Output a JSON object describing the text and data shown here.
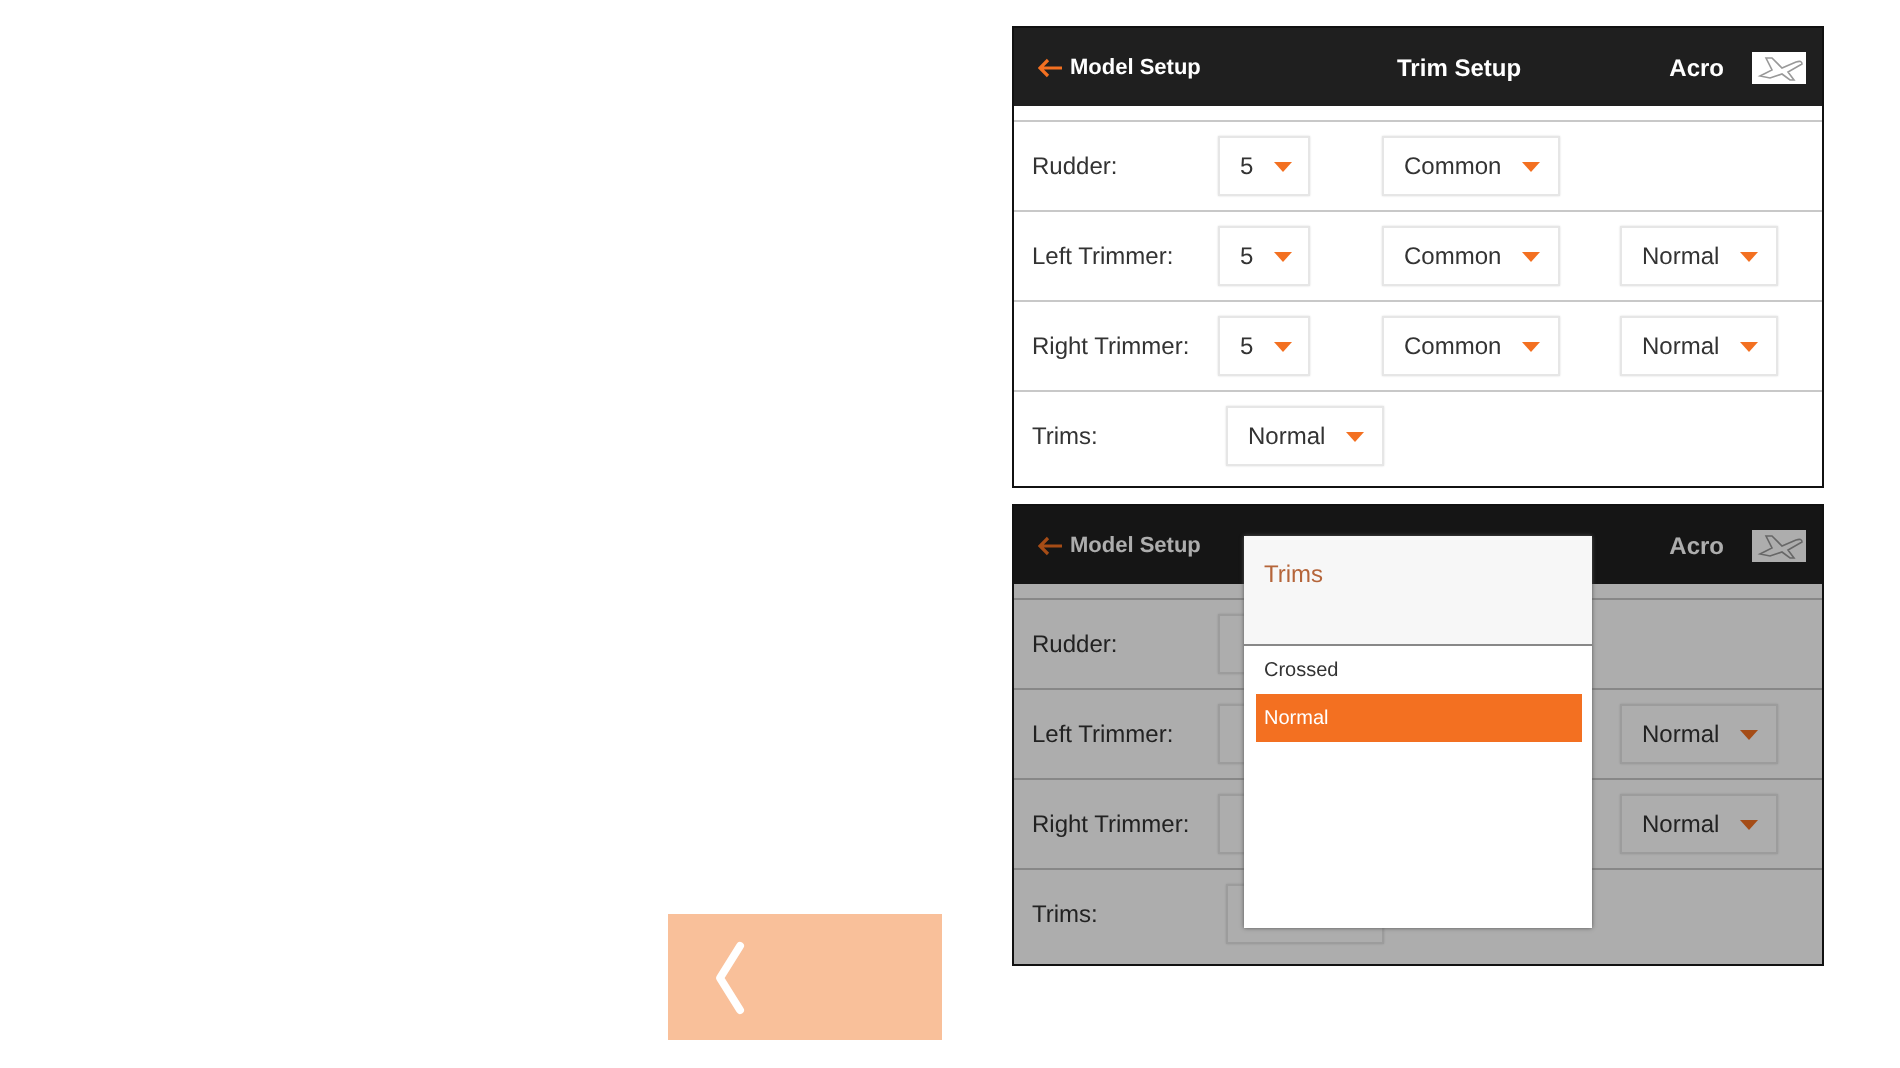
{
  "back_button": {
    "kind": "chevron"
  },
  "screens": [
    {
      "dimmed": false,
      "header": {
        "back_label": "Model Setup",
        "title": "Trim Setup",
        "model": "Acro"
      },
      "rows": [
        {
          "label": "Rudder:",
          "dropdowns": [
            {
              "kind": "channel",
              "value": "5"
            },
            {
              "kind": "mode",
              "value": "Common"
            }
          ]
        },
        {
          "label": "Left Trimmer:",
          "dropdowns": [
            {
              "kind": "channel",
              "value": "5"
            },
            {
              "kind": "mode",
              "value": "Common"
            },
            {
              "kind": "direction",
              "value": "Normal"
            }
          ]
        },
        {
          "label": "Right Trimmer:",
          "dropdowns": [
            {
              "kind": "channel",
              "value": "5"
            },
            {
              "kind": "mode",
              "value": "Common"
            },
            {
              "kind": "direction",
              "value": "Normal"
            }
          ]
        },
        {
          "label": "Trims:",
          "dropdowns": [
            {
              "kind": "trims",
              "value": "Normal"
            }
          ]
        }
      ]
    },
    {
      "dimmed": true,
      "header": {
        "back_label": "Model Setup",
        "model": "Acro"
      },
      "rows": [
        {
          "label": "Rudder:",
          "dropdowns": [
            {
              "kind": "channel"
            }
          ]
        },
        {
          "label": "Left Trimmer:",
          "dropdowns": [
            {
              "kind": "channel"
            },
            {
              "kind": "direction",
              "value": "Normal"
            }
          ]
        },
        {
          "label": "Right Trimmer:",
          "dropdowns": [
            {
              "kind": "channel"
            },
            {
              "kind": "direction",
              "value": "Normal"
            }
          ]
        },
        {
          "label": "Trims:",
          "dropdowns": [
            {
              "kind": "trims"
            }
          ]
        }
      ],
      "dialog": {
        "title": "Trims",
        "options": [
          {
            "label": "Crossed",
            "selected": false
          },
          {
            "label": "Normal",
            "selected": true
          }
        ]
      }
    }
  ]
}
